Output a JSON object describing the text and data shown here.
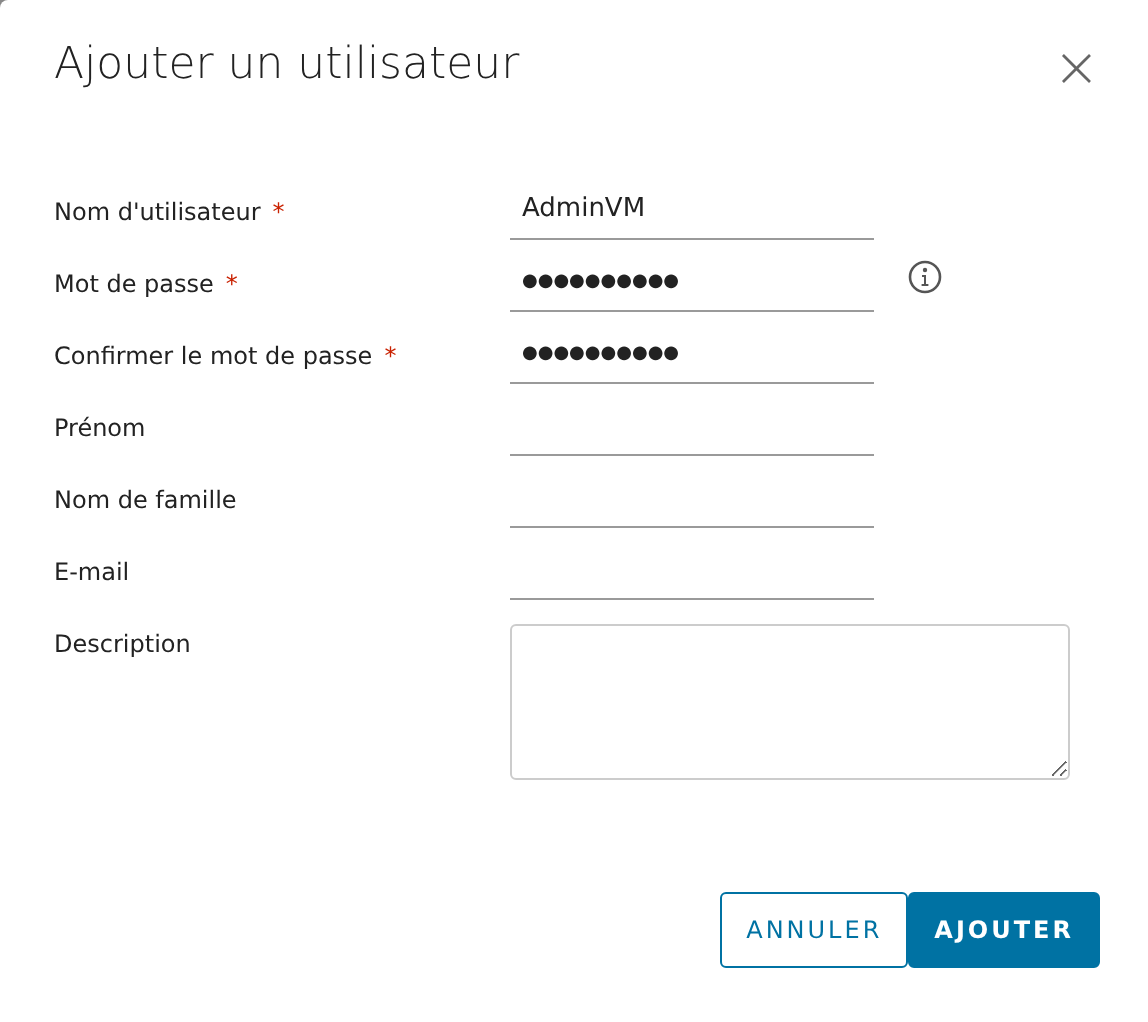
{
  "dialog": {
    "title": "Ajouter un utilisateur",
    "close": "×"
  },
  "fields": [
    {
      "label": "Nom d'utilisateur",
      "required": true,
      "kind": "text",
      "value": "AdminVM",
      "info": false
    },
    {
      "label": "Mot de passe",
      "required": true,
      "kind": "password",
      "value": "●●●●●●●●●●",
      "info": true
    },
    {
      "label": "Confirmer le mot de passe",
      "required": true,
      "kind": "password",
      "value": "●●●●●●●●●●",
      "info": false
    },
    {
      "label": "Prénom",
      "required": false,
      "kind": "text",
      "info": false
    },
    {
      "label": "Nom de famille",
      "required": false,
      "kind": "text",
      "info": false
    },
    {
      "label": "E-mail",
      "required": false,
      "kind": "text",
      "info": false
    },
    {
      "label": "Description",
      "required": false,
      "kind": "textarea",
      "info": false
    }
  ],
  "required_mark": "*",
  "buttons": [
    {
      "label": "ANNULER",
      "kind": "outline"
    },
    {
      "label": "AJOUTER",
      "kind": "primary"
    }
  ]
}
